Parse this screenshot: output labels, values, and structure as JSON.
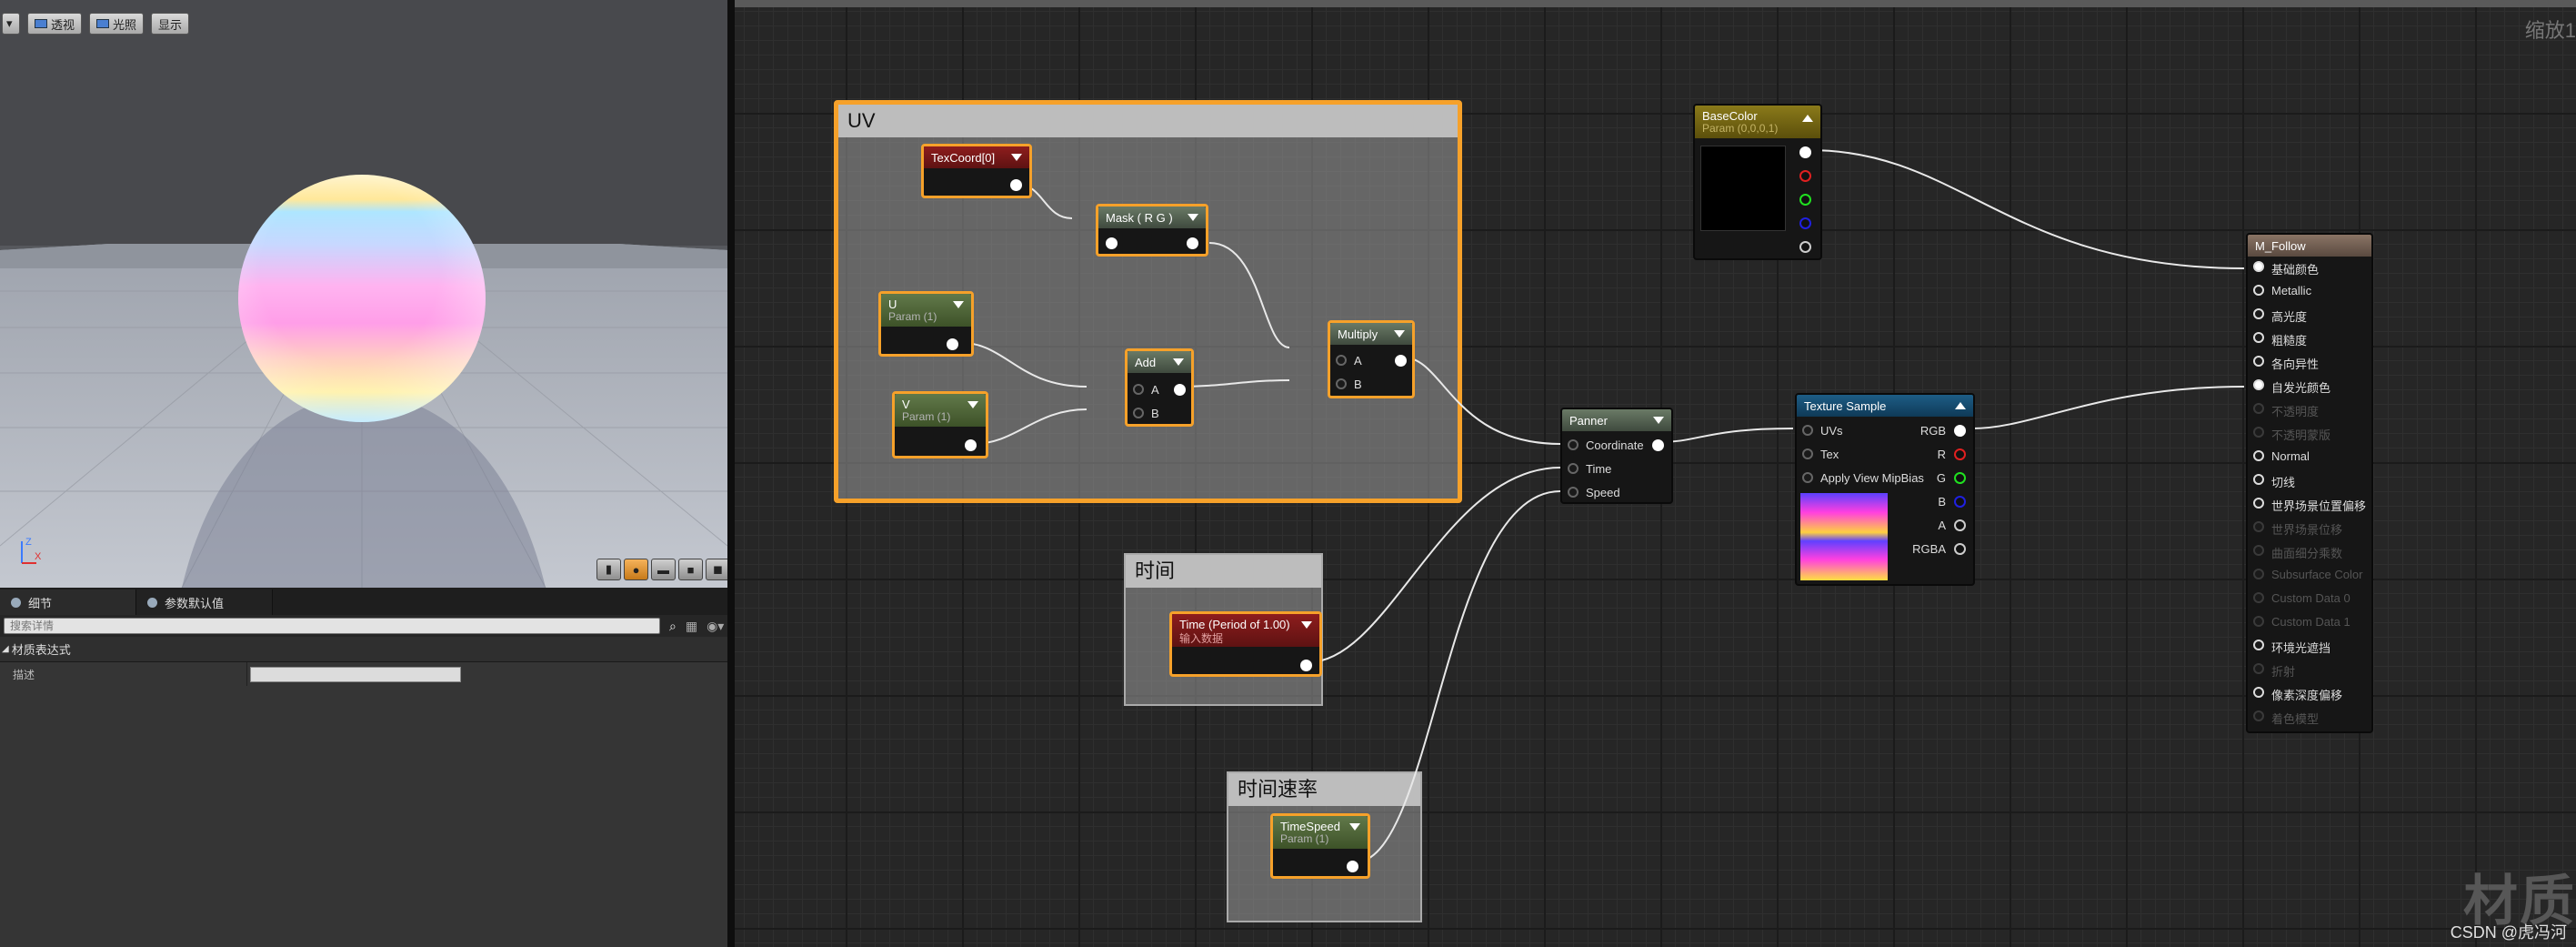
{
  "viewport": {
    "toolbar": {
      "dropdown": "▾",
      "perspective": "透视",
      "lit": "光照",
      "show": "显示"
    },
    "axis": {
      "z": "Z",
      "x": "X"
    }
  },
  "details": {
    "tabs": [
      "细节",
      "参数默认值"
    ],
    "search_placeholder": "搜索详情",
    "category": "材质表达式",
    "property_label": "描述"
  },
  "graph": {
    "zoom_label": "缩放1",
    "watermark": "材质",
    "credit": "CSDN @虎冯河",
    "comments": {
      "uv": "UV",
      "time": "时间",
      "time_speed": "时间速率"
    },
    "nodes": {
      "texcoord": {
        "title": "TexCoord[0]"
      },
      "mask": {
        "title": "Mask ( R G )"
      },
      "u_param": {
        "title": "U",
        "sub": "Param (1)"
      },
      "v_param": {
        "title": "V",
        "sub": "Param (1)"
      },
      "add": {
        "title": "Add",
        "pins": [
          "A",
          "B"
        ]
      },
      "multiply": {
        "title": "Multiply",
        "pins": [
          "A",
          "B"
        ]
      },
      "basecolor": {
        "title": "BaseColor",
        "sub": "Param (0,0,0,1)"
      },
      "panner": {
        "title": "Panner",
        "pins": [
          "Coordinate",
          "Time",
          "Speed"
        ]
      },
      "texture": {
        "title": "Texture Sample",
        "inputs": [
          "UVs",
          "Tex",
          "Apply View MipBias"
        ],
        "outputs": [
          "RGB",
          "R",
          "G",
          "B",
          "A",
          "RGBA"
        ]
      },
      "time": {
        "title": "Time (Period of 1.00)",
        "sub": "输入数据"
      },
      "timespeed": {
        "title": "TimeSpeed",
        "sub": "Param (1)"
      },
      "result": {
        "title": "M_Follow",
        "pins": [
          {
            "label": "基础颜色",
            "active": true
          },
          {
            "label": "Metallic",
            "active": true
          },
          {
            "label": "高光度",
            "active": true
          },
          {
            "label": "粗糙度",
            "active": true
          },
          {
            "label": "各向异性",
            "active": true
          },
          {
            "label": "自发光颜色",
            "active": true
          },
          {
            "label": "不透明度",
            "active": false
          },
          {
            "label": "不透明蒙版",
            "active": false
          },
          {
            "label": "Normal",
            "active": true
          },
          {
            "label": "切线",
            "active": true
          },
          {
            "label": "世界场景位置偏移",
            "active": true
          },
          {
            "label": "世界场景位移",
            "active": false
          },
          {
            "label": "曲面细分乘数",
            "active": false
          },
          {
            "label": "Subsurface Color",
            "active": false
          },
          {
            "label": "Custom Data 0",
            "active": false
          },
          {
            "label": "Custom Data 1",
            "active": false
          },
          {
            "label": "环境光遮挡",
            "active": true
          },
          {
            "label": "折射",
            "active": false
          },
          {
            "label": "像素深度偏移",
            "active": true
          },
          {
            "label": "着色模型",
            "active": false
          }
        ]
      }
    }
  }
}
